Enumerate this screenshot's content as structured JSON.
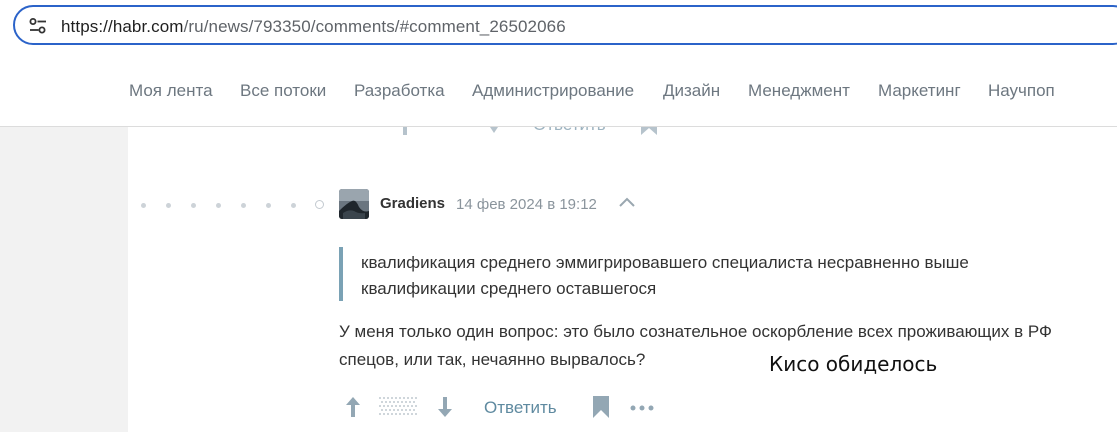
{
  "browser": {
    "url_host": "https://habr.com",
    "url_path": "/ru/news/793350/comments/#comment_26502066",
    "icon": "tune-icon"
  },
  "nav": {
    "items": [
      {
        "label": "Моя лента"
      },
      {
        "label": "Все потоки"
      },
      {
        "label": "Разработка"
      },
      {
        "label": "Администрирование"
      },
      {
        "label": "Дизайн"
      },
      {
        "label": "Менеджмент"
      },
      {
        "label": "Маркетинг"
      },
      {
        "label": "Научпоп"
      }
    ]
  },
  "previous_comment": {
    "reply_label": "Ответить"
  },
  "comment": {
    "username": "Gradiens",
    "time": "14 фев 2024 в 19:12",
    "quote": "квалификация среднего эммигрировавшего специалиста несравненно выше квалификации среднего оставшегося",
    "body": "У меня только один вопрос: это было сознательное оскорбление всех проживающих в РФ спецов, или так, нечаянно вырвалось?",
    "reply_label": "Ответить",
    "icons": [
      "arrow-up-icon",
      "arrow-down-icon",
      "bookmark-icon",
      "more-icon",
      "chevron-up-icon"
    ]
  },
  "overlay": {
    "caption": "Кисо обиделось"
  },
  "colors": {
    "accent": "#2b63c9",
    "link": "#5f8aa0",
    "quote_border": "#7aa2b5"
  }
}
